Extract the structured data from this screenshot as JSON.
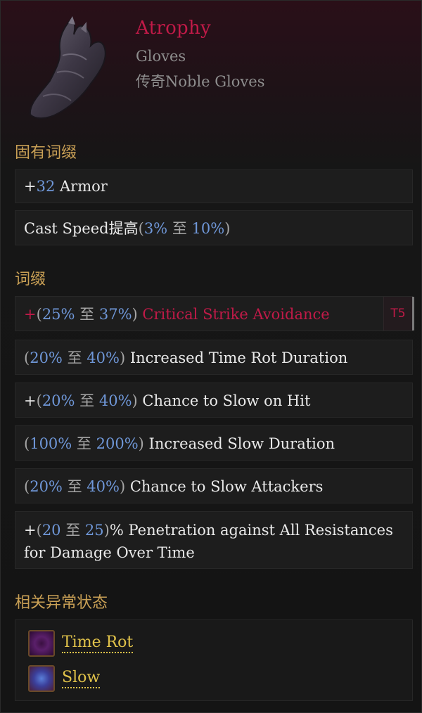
{
  "item": {
    "name": "Atrophy",
    "type": "Gloves",
    "base": "传奇Noble Gloves",
    "name_color": "#c11a48",
    "icon": "gloves-icon"
  },
  "implicit": {
    "title": "固有词缀",
    "rows": [
      {
        "prefix": "+",
        "v1": "32",
        "text": " Armor"
      },
      {
        "text": "Cast Speed提高",
        "open": "(",
        "v1": "3%",
        "mid": " 至 ",
        "v2": "10%",
        "close": ")"
      }
    ]
  },
  "affixes": {
    "title": "词缀",
    "rows": [
      {
        "prefix": "+",
        "open": "(",
        "v1": "25%",
        "mid": " 至 ",
        "v2": "37%",
        "close": ")",
        "text": " Critical Strike Avoidance",
        "tier": "T5"
      },
      {
        "open": "(",
        "v1": "20%",
        "mid": " 至 ",
        "v2": "40%",
        "close": ")",
        "text": " Increased Time Rot Duration"
      },
      {
        "prefix": "+",
        "open": "(",
        "v1": "20%",
        "mid": " 至 ",
        "v2": "40%",
        "close": ")",
        "text": " Chance to Slow on Hit"
      },
      {
        "open": "(",
        "v1": "100%",
        "mid": " 至 ",
        "v2": "200%",
        "close": ")",
        "text": " Increased Slow Duration"
      },
      {
        "open": "(",
        "v1": "20%",
        "mid": " 至 ",
        "v2": "40%",
        "close": ")",
        "text": " Chance to Slow Attackers"
      },
      {
        "prefix": "+",
        "open": "(",
        "v1": "20",
        "mid": " 至 ",
        "v2": "25",
        "close": ")",
        "text": "% Penetration against All Resistances for Damage Over Time"
      }
    ]
  },
  "ailments": {
    "title": "相关异常状态",
    "items": [
      {
        "label": "Time Rot",
        "icon": "time-rot-icon"
      },
      {
        "label": "Slow",
        "icon": "slow-icon"
      }
    ]
  },
  "colors": {
    "accent_red": "#c11a48",
    "value_blue": "#6f97d8",
    "section_gold": "#c9a055",
    "link_yellow": "#e0c24a"
  }
}
